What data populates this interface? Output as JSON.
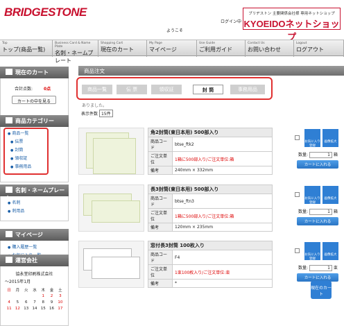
{
  "header": {
    "logo": "BRIDGESTONE",
    "login": "ログイン中",
    "welcome": "ようこそ",
    "shop_sub": "ブリヂストン 主要関係会社様 専用ネットショップ",
    "shop_name": "KYOEIDOネットショップ"
  },
  "nav": [
    {
      "en": "Top",
      "ja": "トップ(商品一覧)"
    },
    {
      "en": "Business Card & Name Plate",
      "ja": "名刺・ネームプレート"
    },
    {
      "en": "Shopping Cart",
      "ja": "現在のカート"
    },
    {
      "en": "My Page",
      "ja": "マイページ"
    },
    {
      "en": "Use Guide",
      "ja": "ご利用ガイド"
    },
    {
      "en": "Contact Us",
      "ja": "お問い合わせ"
    },
    {
      "en": "Logout",
      "ja": "ログアウト"
    }
  ],
  "sidebar": {
    "cart_title": "現在のカート",
    "total_label": "合計点数:",
    "total_value": "0点",
    "cart_button": "カートの中を見る",
    "category_title": "商品カテゴリー",
    "categories": [
      "商品一覧",
      "伝票",
      "封筒",
      "領収証",
      "事務用品"
    ],
    "name_title": "名刺・ネームプレート",
    "name_items": [
      "名刺",
      "刺用品"
    ],
    "mypage_title": "マイページ",
    "mypage_items": [
      "購入履歴一覧",
      "お気に入り一覧"
    ],
    "company_title": "運営会社",
    "company_name": "協永堂印刷株式会社",
    "calendar_month": "～2015年1月",
    "weekdays": [
      "日",
      "月",
      "火",
      "水",
      "木",
      "金",
      "土"
    ],
    "cal_rows": [
      [
        "",
        "",
        "",
        "",
        "1",
        "2",
        "3"
      ],
      [
        "4",
        "5",
        "6",
        "7",
        "8",
        "9",
        "10"
      ],
      [
        "11",
        "12",
        "13",
        "14",
        "15",
        "16",
        "17"
      ]
    ]
  },
  "main": {
    "title": "商品注文",
    "tabs": [
      "商品一覧",
      "伝 票",
      "領収証",
      "封 筒",
      "事務用品"
    ],
    "partial": "ありました。",
    "count_label": "表示件数",
    "count_value": "15件"
  },
  "products": [
    {
      "name": "角2封筒(東日本用) 500部入り",
      "code_label": "商品コード",
      "code": "btse_ftk2",
      "unit_label": "ご注文単位",
      "unit": "1箱に500部入り/ご注文単位:箱",
      "note_label": "備考",
      "note": "240mm × 332mm",
      "qty_label": "数量:",
      "qty": "1",
      "qty_unit": "箱"
    },
    {
      "name": "長3封筒(東日本用) 500部入り",
      "code_label": "商品コード",
      "code": "btse_ftn3",
      "unit_label": "ご注文単位",
      "unit": "1箱に500部入り/ご注文単位:箱",
      "note_label": "備考",
      "note": "120mm × 235mm",
      "qty_label": "数量:",
      "qty": "1",
      "qty_unit": "箱"
    },
    {
      "name": "窓付長3封筒 100枚入り",
      "code_label": "商品コード",
      "code": "F4",
      "unit_label": "ご注文単位",
      "unit": "1束100枚入り/ご注文単位:束",
      "note_label": "備考",
      "note": "*",
      "qty_label": "数量:",
      "qty": "1",
      "qty_unit": "束"
    }
  ],
  "buttons": {
    "favorite": "お気に入り登録",
    "zoom": "画像拡大",
    "add_cart": "カートに入れる",
    "cart_float": "現在のカート"
  },
  "colors": {
    "brand": "#c8102e",
    "highlight": "#e03030",
    "button": "#2f7fd4"
  }
}
